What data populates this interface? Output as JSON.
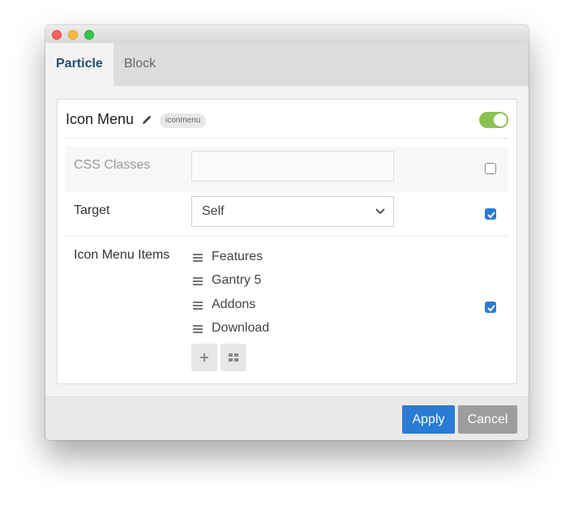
{
  "tabs": [
    {
      "label": "Particle"
    },
    {
      "label": "Block"
    }
  ],
  "panel": {
    "title": "Icon Menu",
    "badge": "iconmenu",
    "enabled": true
  },
  "fields": {
    "css_classes": {
      "label": "CSS Classes",
      "value": "",
      "placeholder": "",
      "override": false
    },
    "target": {
      "label": "Target",
      "value": "Self",
      "override": true
    },
    "menu_items": {
      "label": "Icon Menu Items",
      "override": true,
      "items": [
        "Features",
        "Gantry 5",
        "Addons",
        "Download"
      ]
    }
  },
  "footer": {
    "apply_label": "Apply",
    "cancel_label": "Cancel"
  },
  "colors": {
    "accent": "#2a7bd3",
    "toggle_on": "#8cc152",
    "cancel": "#9d9d9d"
  },
  "icons": [
    "pencil-icon",
    "chevron-down-icon",
    "drag-handle-icon",
    "plus-icon",
    "grid-icon",
    "checkbox-checked-icon"
  ]
}
